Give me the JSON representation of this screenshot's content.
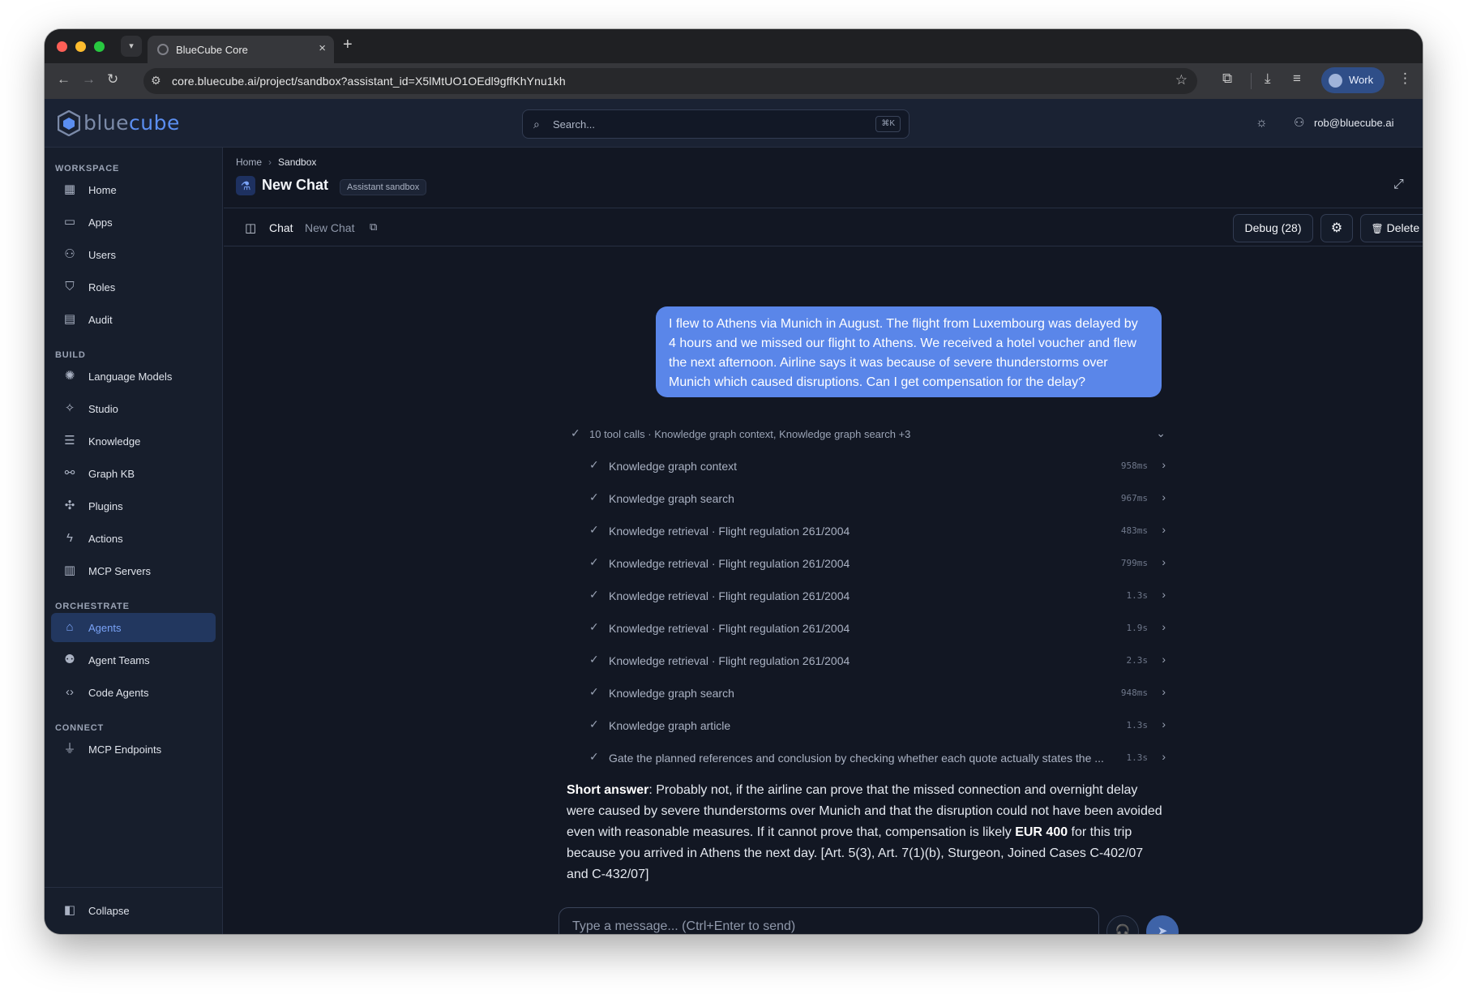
{
  "browser": {
    "tab_title": "BlueCube Core",
    "url": "core.bluecube.ai/project/sandbox?assistant_id=X5lMtUO1OEdl9gffKhYnu1kh",
    "profile_label": "Work"
  },
  "header": {
    "logo_text_a": "blue",
    "logo_text_b": "cube",
    "search_placeholder": "Search...",
    "search_shortcut": "⌘K",
    "user_email": "rob@bluecube.ai"
  },
  "sidebar": {
    "sections": {
      "workspace": "WORKSPACE",
      "build": "BUILD",
      "orchestrate": "ORCHESTRATE",
      "connect": "CONNECT"
    },
    "items": {
      "home": "Home",
      "apps": "Apps",
      "users": "Users",
      "roles": "Roles",
      "audit": "Audit",
      "language_models": "Language Models",
      "studio": "Studio",
      "knowledge": "Knowledge",
      "graph_kb": "Graph KB",
      "plugins": "Plugins",
      "actions": "Actions",
      "mcp_servers": "MCP Servers",
      "agents": "Agents",
      "agent_teams": "Agent Teams",
      "code_agents": "Code Agents",
      "mcp_endpoints": "MCP Endpoints"
    },
    "collapse_label": "Collapse"
  },
  "page": {
    "breadcrumb_home": "Home",
    "breadcrumb_current": "Sandbox",
    "title": "New Chat",
    "badge": "Assistant sandbox"
  },
  "chat_toolbar": {
    "chat_label": "Chat",
    "chat_name": "New Chat",
    "debug_label": "Debug (28)",
    "delete_label": "Delete chat"
  },
  "conversation": {
    "user_message": "I flew to Athens via Munich in August. The flight from Luxembourg was delayed by 4 hours and we missed our flight to Athens. We received a hotel voucher and flew the next afternoon. Airline says it was because of severe thunderstorms over Munich which caused disruptions. Can I get compensation for the delay?",
    "tool_summary": "10 tool calls · Knowledge graph context, Knowledge graph search +3",
    "tool_calls": [
      {
        "name": "Knowledge graph context",
        "duration": "958ms"
      },
      {
        "name": "Knowledge graph search",
        "duration": "967ms"
      },
      {
        "name": "Knowledge retrieval · Flight regulation 261/2004",
        "duration": "483ms"
      },
      {
        "name": "Knowledge retrieval · Flight regulation 261/2004",
        "duration": "799ms"
      },
      {
        "name": "Knowledge retrieval · Flight regulation 261/2004",
        "duration": "1.3s"
      },
      {
        "name": "Knowledge retrieval · Flight regulation 261/2004",
        "duration": "1.9s"
      },
      {
        "name": "Knowledge retrieval · Flight regulation 261/2004",
        "duration": "2.3s"
      },
      {
        "name": "Knowledge graph search",
        "duration": "948ms"
      },
      {
        "name": "Knowledge graph article",
        "duration": "1.3s"
      },
      {
        "name": "Gate the planned references and conclusion by checking whether each quote actually states the ...",
        "duration": "1.3s"
      }
    ],
    "answer_lead": "Short answer",
    "answer_part1": ": Probably not, if the airline can prove that the missed connection and overnight delay were caused by severe thunderstorms over Munich and that the disruption could not have been avoided even with reasonable measures. If it cannot prove that, compensation is likely ",
    "answer_amount": "EUR 400",
    "answer_part2": " for this trip because you arrived in Athens the next day. [Art. 5(3), Art. 7(1)(b), Sturgeon, Joined Cases C-402/07 and C-432/07]"
  },
  "composer": {
    "placeholder": "Type a message... (Ctrl+Enter to send)"
  },
  "colors": {
    "accent": "#5a86e9",
    "active_nav_bg": "#22375f",
    "app_bg": "#121723"
  }
}
